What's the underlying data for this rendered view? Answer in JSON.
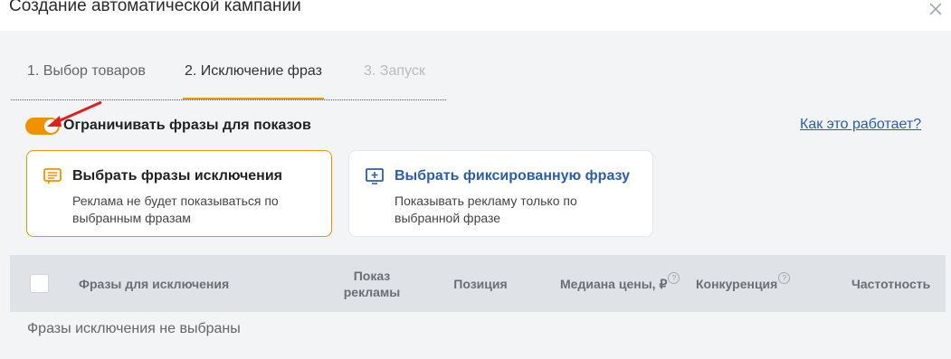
{
  "dialog": {
    "title": "Создание автоматической кампании"
  },
  "tabs": [
    {
      "label": "1. Выбор товаров"
    },
    {
      "label": "2. Исключение фраз"
    },
    {
      "label": "3. Запуск"
    }
  ],
  "toggle": {
    "label": "Ограничивать фразы для показов",
    "on": true
  },
  "help_link": "Как это работает?",
  "cards": [
    {
      "title": "Выбрать фразы исключения",
      "description": "Реклама не будет показываться по выбранным фразам",
      "icon": "list-icon"
    },
    {
      "title": "Выбрать фиксированную фразу",
      "description": "Показывать рекламу только по выбранной фразе",
      "icon": "monitor-plus-icon"
    }
  ],
  "table": {
    "headers": [
      "Фразы для исключения",
      "Показ рекламы",
      "Позиция",
      "Медиана цены, ₽",
      "Конкуренция",
      "Частотность"
    ],
    "help_mark": "?",
    "empty_text": "Фразы исключения не выбраны"
  },
  "colors": {
    "accent": "#f29100",
    "link": "#2c5ea8",
    "annotation": "#e02020"
  }
}
